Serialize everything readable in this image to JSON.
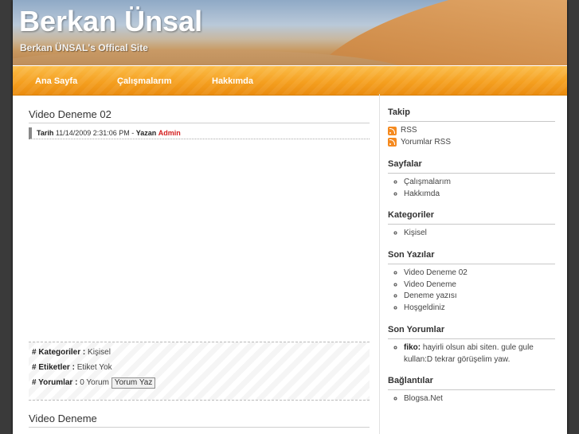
{
  "header": {
    "site_title": "Berkan Ünsal",
    "site_description": "Berkan ÜNSAL's Offical Site"
  },
  "nav": {
    "items": [
      "Ana Sayfa",
      "Çalışmalarım",
      "Hakkımda"
    ]
  },
  "post": {
    "title": "Video Deneme 02",
    "date_label": "Tarih",
    "date": "11/14/2009 2:31:06 PM",
    "separator": " - ",
    "author_label": "Yazan",
    "author": "Admin",
    "categories_label": "# Kategoriler :",
    "categories": "Kişisel",
    "tags_label": "# Etiketler :",
    "tags": "Etiket Yok",
    "comments_label": "# Yorumlar :",
    "comments": "0 Yorum",
    "write_comment": "Yorum Yaz"
  },
  "next_post": {
    "title": "Video Deneme"
  },
  "sidebar": {
    "follow": {
      "title": "Takip",
      "items": [
        "RSS",
        "Yorumlar RSS"
      ]
    },
    "pages": {
      "title": "Sayfalar",
      "items": [
        "Çalışmalarım",
        "Hakkımda"
      ]
    },
    "categories": {
      "title": "Kategoriler",
      "items": [
        "Kişisel"
      ]
    },
    "recent_posts": {
      "title": "Son Yazılar",
      "items": [
        "Video Deneme 02",
        "Video Deneme",
        "Deneme yazısı",
        "Hoşgeldiniz"
      ]
    },
    "recent_comments": {
      "title": "Son Yorumlar",
      "items": [
        {
          "author": "fiko:",
          "text": "hayirli olsun abi siten. gule gule kullan:D tekrar görüşelim yaw."
        }
      ]
    },
    "links": {
      "title": "Bağlantılar",
      "items": [
        "Blogsa.Net"
      ]
    }
  }
}
